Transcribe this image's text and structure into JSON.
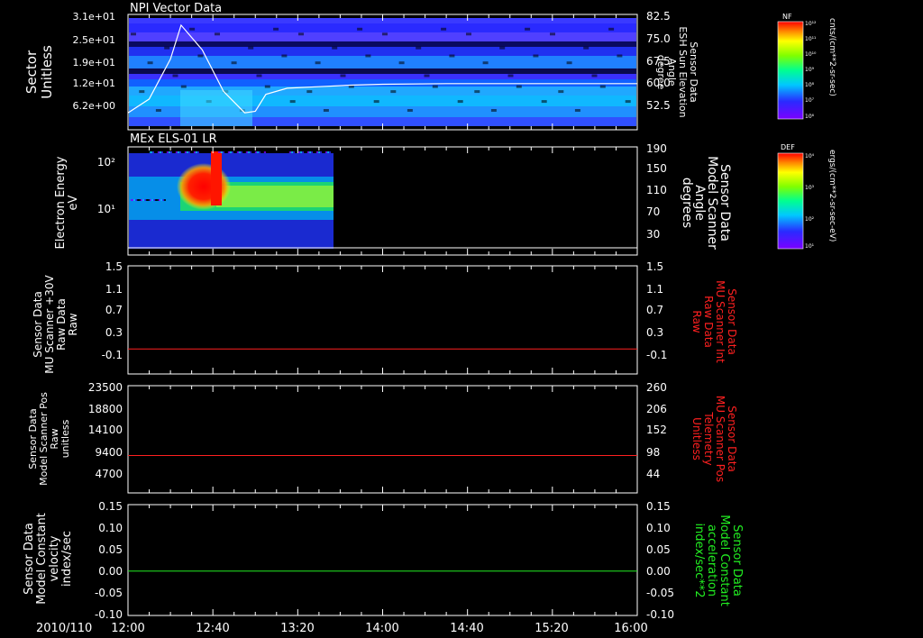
{
  "date_label": "2010/110",
  "time_axis": {
    "start": "12:00",
    "end": "16:00",
    "ticks": [
      "12:00",
      "12:40",
      "13:20",
      "14:00",
      "14:40",
      "15:20",
      "16:00"
    ]
  },
  "colors": {
    "background": "#000000",
    "axis": "#ffffff",
    "red_trace": "#ff2020",
    "green_trace": "#22ee22",
    "red_label": "#ff2020",
    "green_label": "#22ee22"
  },
  "colorbars": [
    {
      "title": "NF",
      "unit": "cnts/(cm**2-sr-sec)",
      "tick_labels": [
        "10¹²",
        "10¹¹",
        "10¹⁰",
        "10⁹",
        "10⁸",
        "10⁷",
        "10⁶"
      ]
    },
    {
      "title": "DEF",
      "unit": "ergs/(cm**2-sr-sec-eV)",
      "tick_labels": [
        "10⁴",
        "10³",
        "10²",
        "10¹"
      ]
    }
  ],
  "chart_data": [
    {
      "type": "heatmap",
      "title": "NPI Vector Data",
      "ylabel": [
        "Sector",
        "Unitless"
      ],
      "ytick_labels": [
        "3.1e+01",
        "2.5e+01",
        "1.9e+01",
        "1.2e+01",
        "6.2e+00"
      ],
      "right_ylabel": [
        "Sensor Data",
        "ESH Sun Elevation",
        "Angle",
        "degree"
      ],
      "right_ytick_labels": [
        "82.5",
        "75.0",
        "67.5",
        "60.0",
        "52.5"
      ],
      "right_ylim": [
        45.0,
        82.5
      ],
      "overlay_line": {
        "name": "Sensor Data ESH Sun Elevation Angle",
        "x": [
          "12:00",
          "12:10",
          "12:20",
          "12:25",
          "12:35",
          "12:45",
          "12:55",
          "13:00",
          "13:05",
          "13:15",
          "13:30",
          "13:45",
          "14:00",
          "14:30",
          "15:00",
          "15:30",
          "16:00"
        ],
        "y": [
          50.5,
          55.0,
          68.0,
          79.0,
          71.0,
          57.5,
          50.5,
          51.0,
          56.5,
          58.5,
          59.0,
          59.5,
          59.8,
          60.0,
          60.0,
          60.0,
          60.0
        ]
      }
    },
    {
      "type": "heatmap",
      "title": "MEx ELS-01 LR",
      "ylabel": [
        "Electron Energy",
        "eV"
      ],
      "ytick_labels": [
        "10²",
        "10¹"
      ],
      "right_ylabel": [
        "Sensor Data",
        "Model Scanner",
        "Angle",
        "degrees"
      ],
      "right_ytick_labels": [
        "190",
        "150",
        "110",
        "70",
        "30"
      ],
      "data_extent": [
        "12:00",
        "13:35"
      ]
    },
    {
      "type": "line",
      "ylabel": [
        "Sensor Data",
        "MU Scanner +30V",
        "Raw Data",
        "Raw"
      ],
      "ytick_labels": [
        "1.5",
        "1.1",
        "0.7",
        "0.3",
        "-0.1"
      ],
      "right_ylabel": [
        "Sensor Data",
        "MU Scanner Int",
        "Raw Data",
        "Raw"
      ],
      "right_ytick_labels": [
        "1.5",
        "1.1",
        "0.7",
        "0.3",
        "-0.1"
      ],
      "ylim": [
        -0.45,
        1.5
      ],
      "series": [
        {
          "x": [
            "12:00",
            "16:00"
          ],
          "y": [
            0.0,
            0.0
          ],
          "color": "#ff2020"
        }
      ]
    },
    {
      "type": "line",
      "ylabel": [
        "Sensor Data",
        "Model Scanner Pos",
        "Raw",
        "unitless"
      ],
      "ytick_labels": [
        "23500",
        "18800",
        "14100",
        "9400",
        "4700"
      ],
      "right_ylabel": [
        "Sensor Data",
        "MU Scanner Pos",
        "Telemetry",
        "Unitless"
      ],
      "right_ytick_labels": [
        "260",
        "206",
        "152",
        "98",
        "44"
      ],
      "ylim": [
        0,
        23500
      ],
      "series": [
        {
          "x": [
            "12:00",
            "16:00"
          ],
          "y": [
            8200,
            8200
          ],
          "color": "#ff2020"
        }
      ]
    },
    {
      "type": "line",
      "ylabel": [
        "Sensor Data",
        "Model Constant",
        "velocity",
        "index/sec"
      ],
      "ytick_labels": [
        "0.15",
        "0.10",
        "0.05",
        "0.00",
        "-0.05",
        "-0.10"
      ],
      "right_ylabel": [
        "Sensor Data",
        "Model Constant",
        "acceleration",
        "index/sec**2"
      ],
      "right_ytick_labels": [
        "0.15",
        "0.10",
        "0.05",
        "0.00",
        "-0.05",
        "-0.10"
      ],
      "ylim": [
        -0.1,
        0.15
      ],
      "series": [
        {
          "x": [
            "12:00",
            "16:00"
          ],
          "y": [
            0.0,
            0.0
          ],
          "color": "#22ee22"
        }
      ]
    }
  ]
}
